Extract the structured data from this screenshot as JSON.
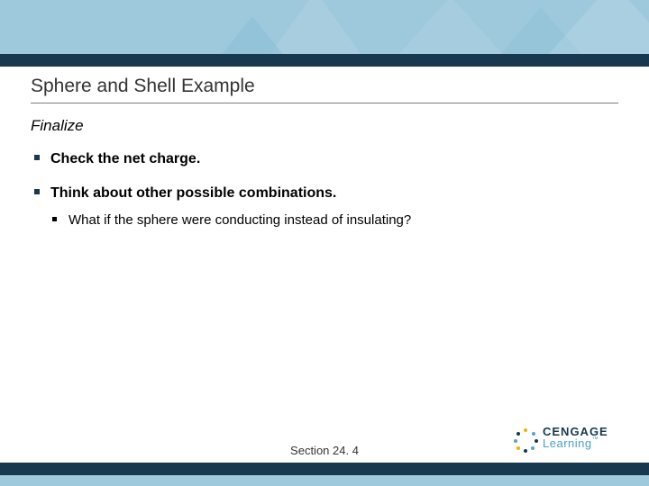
{
  "title": "Sphere and Shell Example",
  "subhead": "Finalize",
  "bullets": {
    "b0": {
      "text": "Check the net charge."
    },
    "b1": {
      "text": "Think about other possible combinations.",
      "sub0": "What if the sphere were conducting instead of insulating?"
    }
  },
  "footer": {
    "section_label": "Section  24. 4"
  },
  "logo": {
    "line1": "CENGAGE",
    "line2": "Learning",
    "tm": "™"
  }
}
